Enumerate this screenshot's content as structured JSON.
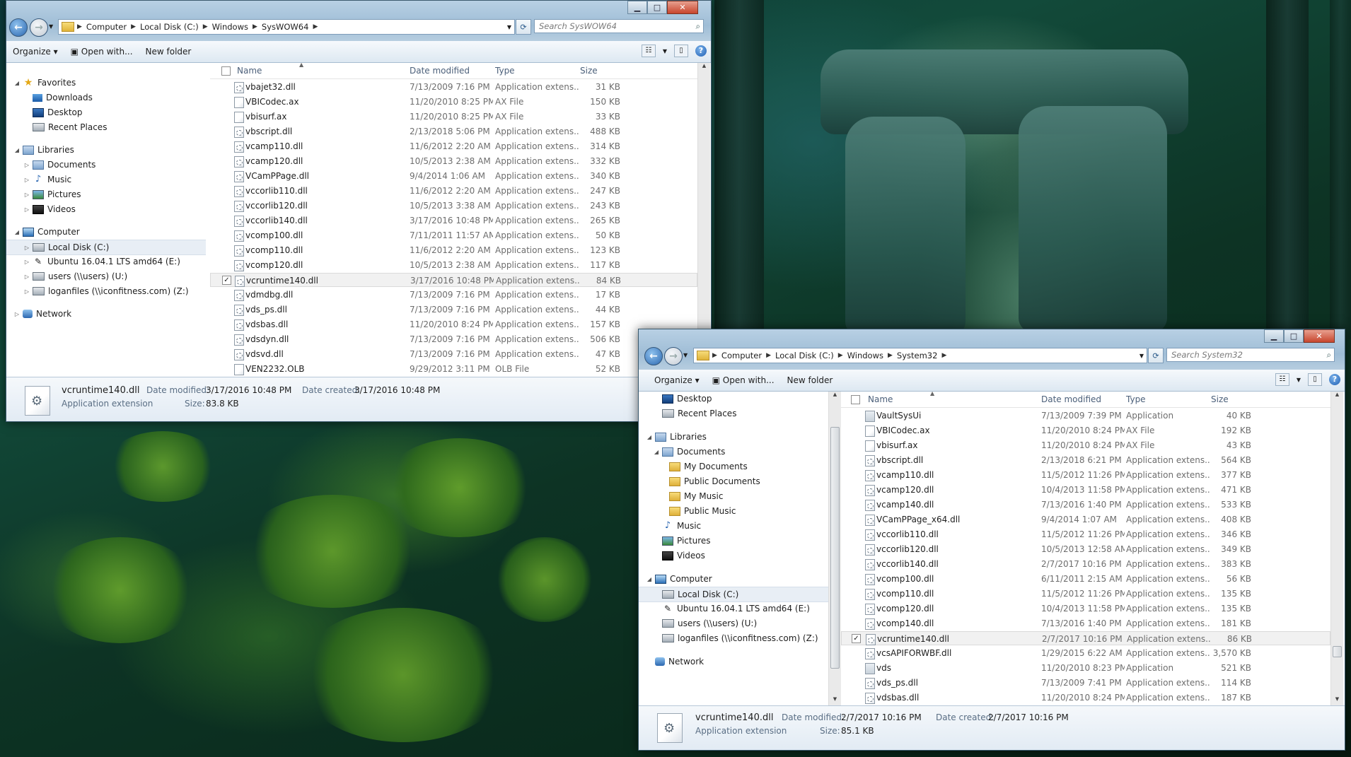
{
  "window1": {
    "address": [
      "Computer",
      "Local Disk (C:)",
      "Windows",
      "SysWOW64"
    ],
    "search_placeholder": "Search SysWOW64",
    "toolbar": {
      "organize": "Organize",
      "open_with": "Open with...",
      "new_folder": "New folder"
    },
    "columns": {
      "name": "Name",
      "date": "Date modified",
      "type": "Type",
      "size": "Size"
    },
    "nav": {
      "favorites": "Favorites",
      "downloads": "Downloads",
      "desktop": "Desktop",
      "recent": "Recent Places",
      "libraries": "Libraries",
      "documents": "Documents",
      "music": "Music",
      "pictures": "Pictures",
      "videos": "Videos",
      "computer": "Computer",
      "local_disk": "Local Disk (C:)",
      "ubuntu": "Ubuntu 16.04.1 LTS amd64 (E:)",
      "users": "users (\\\\users) (U:)",
      "loganfiles": "loganfiles (\\\\iconfitness.com) (Z:)",
      "network": "Network"
    },
    "files": [
      {
        "name": "vbajet32.dll",
        "date": "7/13/2009 7:16 PM",
        "type": "Application extens...",
        "size": "31 KB",
        "icon": "dll"
      },
      {
        "name": "VBICodec.ax",
        "date": "11/20/2010 8:25 PM",
        "type": "AX File",
        "size": "150 KB",
        "icon": "file"
      },
      {
        "name": "vbisurf.ax",
        "date": "11/20/2010 8:25 PM",
        "type": "AX File",
        "size": "33 KB",
        "icon": "file"
      },
      {
        "name": "vbscript.dll",
        "date": "2/13/2018 5:06 PM",
        "type": "Application extens...",
        "size": "488 KB",
        "icon": "dll"
      },
      {
        "name": "vcamp110.dll",
        "date": "11/6/2012 2:20 AM",
        "type": "Application extens...",
        "size": "314 KB",
        "icon": "dll"
      },
      {
        "name": "vcamp120.dll",
        "date": "10/5/2013 2:38 AM",
        "type": "Application extens...",
        "size": "332 KB",
        "icon": "dll"
      },
      {
        "name": "VCamPPage.dll",
        "date": "9/4/2014 1:06 AM",
        "type": "Application extens...",
        "size": "340 KB",
        "icon": "dll"
      },
      {
        "name": "vccorlib110.dll",
        "date": "11/6/2012 2:20 AM",
        "type": "Application extens...",
        "size": "247 KB",
        "icon": "dll"
      },
      {
        "name": "vccorlib120.dll",
        "date": "10/5/2013 3:38 AM",
        "type": "Application extens...",
        "size": "243 KB",
        "icon": "dll"
      },
      {
        "name": "vccorlib140.dll",
        "date": "3/17/2016 10:48 PM",
        "type": "Application extens...",
        "size": "265 KB",
        "icon": "dll"
      },
      {
        "name": "vcomp100.dll",
        "date": "7/11/2011 11:57 AM",
        "type": "Application extens...",
        "size": "50 KB",
        "icon": "dll"
      },
      {
        "name": "vcomp110.dll",
        "date": "11/6/2012 2:20 AM",
        "type": "Application extens...",
        "size": "123 KB",
        "icon": "dll"
      },
      {
        "name": "vcomp120.dll",
        "date": "10/5/2013 2:38 AM",
        "type": "Application extens...",
        "size": "117 KB",
        "icon": "dll"
      },
      {
        "name": "vcruntime140.dll",
        "date": "3/17/2016 10:48 PM",
        "type": "Application extens...",
        "size": "84 KB",
        "icon": "dll",
        "selected": true
      },
      {
        "name": "vdmdbg.dll",
        "date": "7/13/2009 7:16 PM",
        "type": "Application extens...",
        "size": "17 KB",
        "icon": "dll"
      },
      {
        "name": "vds_ps.dll",
        "date": "7/13/2009 7:16 PM",
        "type": "Application extens...",
        "size": "44 KB",
        "icon": "dll"
      },
      {
        "name": "vdsbas.dll",
        "date": "11/20/2010 8:24 PM",
        "type": "Application extens...",
        "size": "157 KB",
        "icon": "dll"
      },
      {
        "name": "vdsdyn.dll",
        "date": "7/13/2009 7:16 PM",
        "type": "Application extens...",
        "size": "506 KB",
        "icon": "dll"
      },
      {
        "name": "vdsvd.dll",
        "date": "7/13/2009 7:16 PM",
        "type": "Application extens...",
        "size": "47 KB",
        "icon": "dll"
      },
      {
        "name": "VEN2232.OLB",
        "date": "9/29/2012 3:11 PM",
        "type": "OLB File",
        "size": "52 KB",
        "icon": "file"
      }
    ],
    "details": {
      "filename": "vcruntime140.dll",
      "filetype": "Application extension",
      "modified_label": "Date modified:",
      "modified": "3/17/2016 10:48 PM",
      "created_label": "Date created:",
      "created": "3/17/2016 10:48 PM",
      "size_label": "Size:",
      "size": "83.8 KB"
    }
  },
  "window2": {
    "address": [
      "Computer",
      "Local Disk (C:)",
      "Windows",
      "System32"
    ],
    "search_placeholder": "Search System32",
    "toolbar": {
      "organize": "Organize",
      "open_with": "Open with...",
      "new_folder": "New folder"
    },
    "columns": {
      "name": "Name",
      "date": "Date modified",
      "type": "Type",
      "size": "Size"
    },
    "nav": {
      "desktop": "Desktop",
      "recent": "Recent Places",
      "libraries": "Libraries",
      "documents": "Documents",
      "my_documents": "My Documents",
      "public_documents": "Public Documents",
      "my_music": "My Music",
      "public_music": "Public Music",
      "music": "Music",
      "pictures": "Pictures",
      "videos": "Videos",
      "computer": "Computer",
      "local_disk": "Local Disk (C:)",
      "ubuntu": "Ubuntu 16.04.1 LTS amd64 (E:)",
      "users": "users (\\\\users) (U:)",
      "loganfiles": "loganfiles (\\\\iconfitness.com) (Z:)",
      "network": "Network"
    },
    "files": [
      {
        "name": "VaultSysUi",
        "date": "7/13/2009 7:39 PM",
        "type": "Application",
        "size": "40 KB",
        "icon": "app"
      },
      {
        "name": "VBICodec.ax",
        "date": "11/20/2010 8:24 PM",
        "type": "AX File",
        "size": "192 KB",
        "icon": "file"
      },
      {
        "name": "vbisurf.ax",
        "date": "11/20/2010 8:24 PM",
        "type": "AX File",
        "size": "43 KB",
        "icon": "file"
      },
      {
        "name": "vbscript.dll",
        "date": "2/13/2018 6:21 PM",
        "type": "Application extens...",
        "size": "564 KB",
        "icon": "dll"
      },
      {
        "name": "vcamp110.dll",
        "date": "11/5/2012 11:26 PM",
        "type": "Application extens...",
        "size": "377 KB",
        "icon": "dll"
      },
      {
        "name": "vcamp120.dll",
        "date": "10/4/2013 11:58 PM",
        "type": "Application extens...",
        "size": "471 KB",
        "icon": "dll"
      },
      {
        "name": "vcamp140.dll",
        "date": "7/13/2016 1:40 PM",
        "type": "Application extens...",
        "size": "533 KB",
        "icon": "dll"
      },
      {
        "name": "VCamPPage_x64.dll",
        "date": "9/4/2014 1:07 AM",
        "type": "Application extens...",
        "size": "408 KB",
        "icon": "dll"
      },
      {
        "name": "vccorlib110.dll",
        "date": "11/5/2012 11:26 PM",
        "type": "Application extens...",
        "size": "346 KB",
        "icon": "dll"
      },
      {
        "name": "vccorlib120.dll",
        "date": "10/5/2013 12:58 AM",
        "type": "Application extens...",
        "size": "349 KB",
        "icon": "dll"
      },
      {
        "name": "vccorlib140.dll",
        "date": "2/7/2017 10:16 PM",
        "type": "Application extens...",
        "size": "383 KB",
        "icon": "dll"
      },
      {
        "name": "vcomp100.dll",
        "date": "6/11/2011 2:15 AM",
        "type": "Application extens...",
        "size": "56 KB",
        "icon": "dll"
      },
      {
        "name": "vcomp110.dll",
        "date": "11/5/2012 11:26 PM",
        "type": "Application extens...",
        "size": "135 KB",
        "icon": "dll"
      },
      {
        "name": "vcomp120.dll",
        "date": "10/4/2013 11:58 PM",
        "type": "Application extens...",
        "size": "135 KB",
        "icon": "dll"
      },
      {
        "name": "vcomp140.dll",
        "date": "7/13/2016 1:40 PM",
        "type": "Application extens...",
        "size": "181 KB",
        "icon": "dll"
      },
      {
        "name": "vcruntime140.dll",
        "date": "2/7/2017 10:16 PM",
        "type": "Application extens...",
        "size": "86 KB",
        "icon": "dll",
        "selected": true
      },
      {
        "name": "vcsAPIFORWBF.dll",
        "date": "1/29/2015 6:22 AM",
        "type": "Application extens...",
        "size": "3,570 KB",
        "icon": "dll"
      },
      {
        "name": "vds",
        "date": "11/20/2010 8:23 PM",
        "type": "Application",
        "size": "521 KB",
        "icon": "app"
      },
      {
        "name": "vds_ps.dll",
        "date": "7/13/2009 7:41 PM",
        "type": "Application extens...",
        "size": "114 KB",
        "icon": "dll"
      },
      {
        "name": "vdsbas.dll",
        "date": "11/20/2010 8:24 PM",
        "type": "Application extens...",
        "size": "187 KB",
        "icon": "dll"
      }
    ],
    "details": {
      "filename": "vcruntime140.dll",
      "filetype": "Application extension",
      "modified_label": "Date modified:",
      "modified": "2/7/2017 10:16 PM",
      "created_label": "Date created:",
      "created": "2/7/2017 10:16 PM",
      "size_label": "Size:",
      "size": "85.1 KB"
    }
  },
  "caption_glyphs": {
    "minimize": "▁",
    "maximize": "□",
    "close": "✕"
  }
}
